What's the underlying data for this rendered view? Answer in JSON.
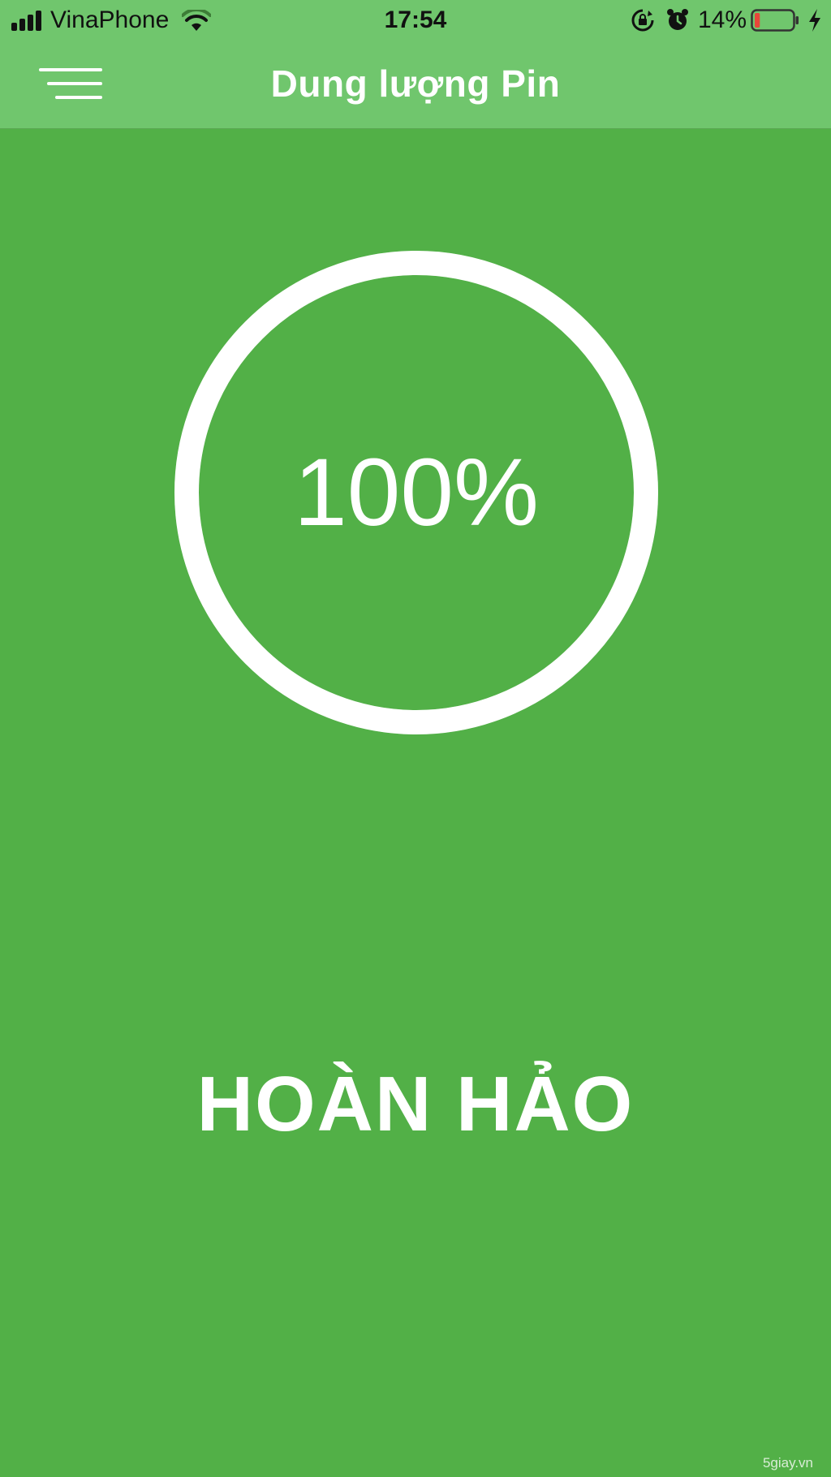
{
  "status_bar": {
    "carrier": "VinaPhone",
    "time": "17:54",
    "battery_percent": "14%",
    "battery_level": 0.14,
    "battery_color": "#e8463a",
    "icons": [
      "signal-icon",
      "wifi-icon",
      "rotation-lock-icon",
      "alarm-icon",
      "battery-icon",
      "charging-bolt-icon"
    ]
  },
  "nav": {
    "title": "Dung lượng Pin",
    "menu_icon": "hamburger-menu-icon"
  },
  "gauge": {
    "value_text": "100%",
    "value": 1.0
  },
  "status": {
    "label": "HOÀN HẢO"
  },
  "watermark": "5giay.vn",
  "colors": {
    "background": "#52b047",
    "header": "#70c66d",
    "foreground": "#ffffff"
  }
}
